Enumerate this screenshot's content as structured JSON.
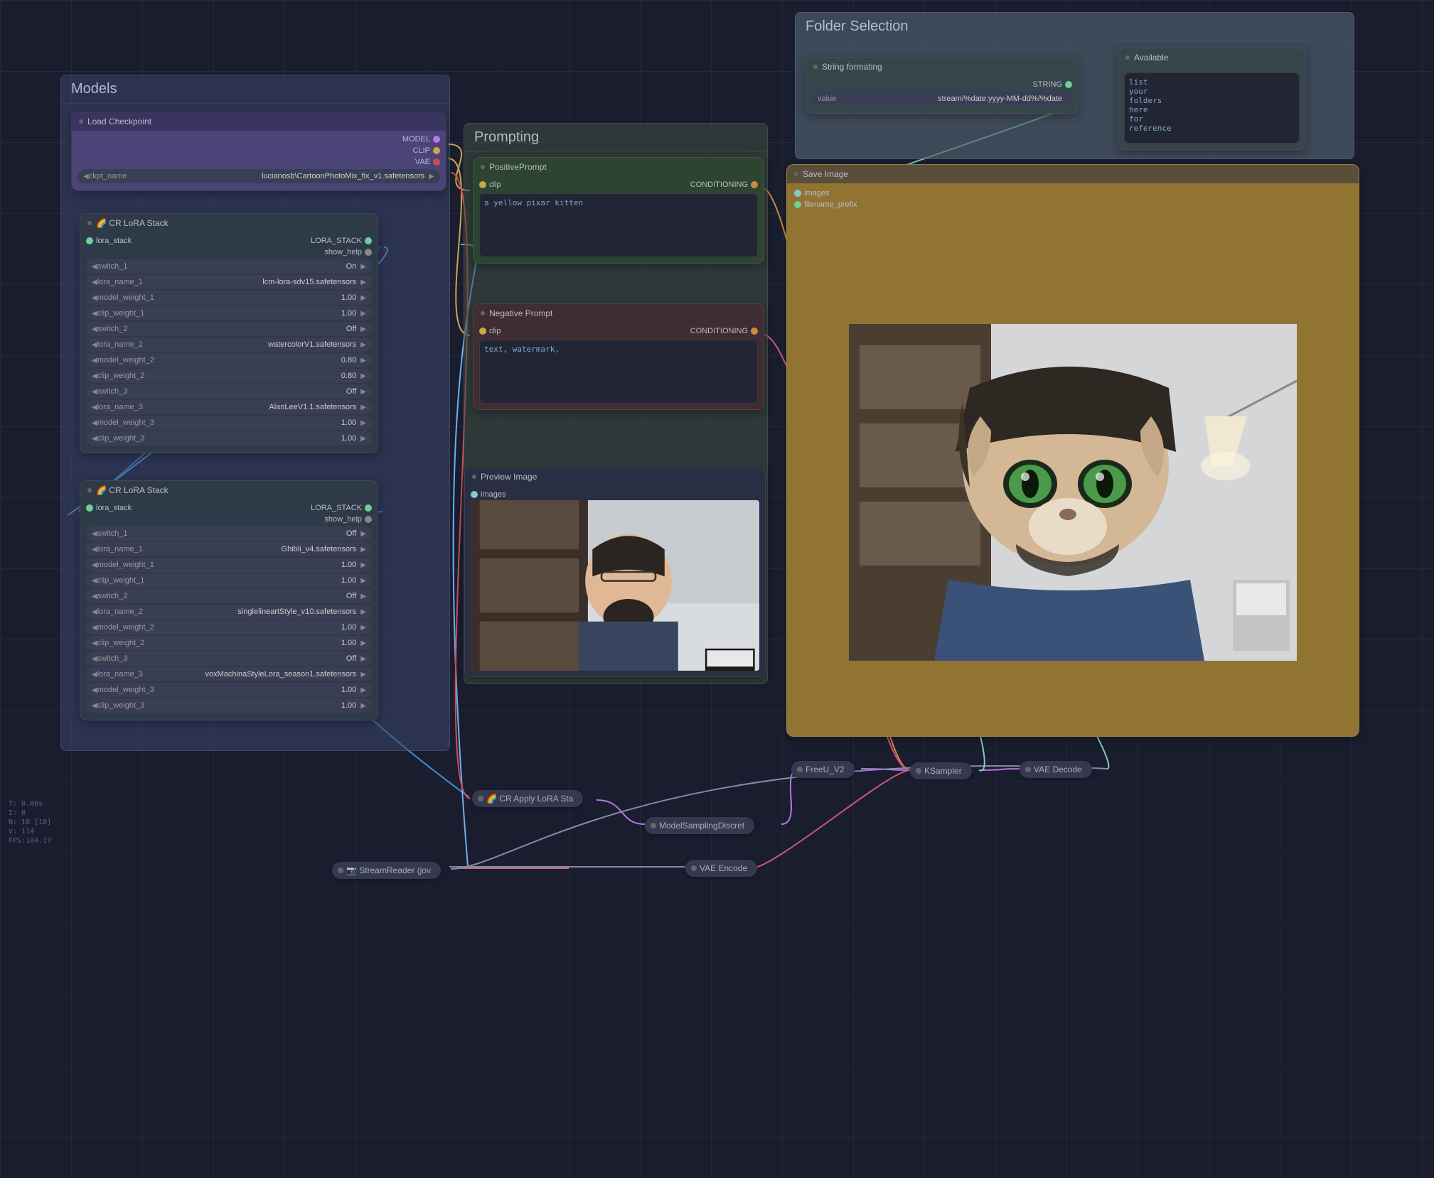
{
  "groups": {
    "models": {
      "title": "Models"
    },
    "prompting": {
      "title": "Prompting"
    },
    "folder": {
      "title": "Folder Selection"
    }
  },
  "nodes": {
    "load_checkpoint": {
      "title": "Load Checkpoint",
      "outputs": [
        "MODEL",
        "CLIP",
        "VAE"
      ],
      "widgets": [
        {
          "label": "ckpt_name",
          "value": "lucianosb\\CartoonPhotoMix_fix_v1.safetensors"
        }
      ]
    },
    "lora_stack_1": {
      "title": "🌈 CR LoRA Stack",
      "outputs": [
        "LORA_STACK",
        "show_help"
      ],
      "inputs": [
        "lora_stack"
      ],
      "widgets": [
        {
          "label": "switch_1",
          "value": "On"
        },
        {
          "label": "lora_name_1",
          "value": "lcm-lora-sdv15.safetensors"
        },
        {
          "label": "model_weight_1",
          "value": "1.00"
        },
        {
          "label": "clip_weight_1",
          "value": "1.00"
        },
        {
          "label": "switch_2",
          "value": "Off"
        },
        {
          "label": "lora_name_2",
          "value": "watercolorV1.safetensors"
        },
        {
          "label": "model_weight_2",
          "value": "0.80"
        },
        {
          "label": "clip_weight_2",
          "value": "0.80"
        },
        {
          "label": "switch_3",
          "value": "Off"
        },
        {
          "label": "lora_name_3",
          "value": "AlanLeeV1.1.safetensors"
        },
        {
          "label": "model_weight_3",
          "value": "1.00"
        },
        {
          "label": "clip_weight_3",
          "value": "1.00"
        }
      ]
    },
    "lora_stack_2": {
      "title": "🌈 CR LoRA Stack",
      "outputs": [
        "LORA_STACK",
        "show_help"
      ],
      "inputs": [
        "lora_stack"
      ],
      "widgets": [
        {
          "label": "switch_1",
          "value": "Off"
        },
        {
          "label": "lora_name_1",
          "value": "Ghibli_v4.safetensors"
        },
        {
          "label": "model_weight_1",
          "value": "1.00"
        },
        {
          "label": "clip_weight_1",
          "value": "1.00"
        },
        {
          "label": "switch_2",
          "value": "Off"
        },
        {
          "label": "lora_name_2",
          "value": "singlelineartStyle_v10.safetensors"
        },
        {
          "label": "model_weight_2",
          "value": "1.00"
        },
        {
          "label": "clip_weight_2",
          "value": "1.00"
        },
        {
          "label": "switch_3",
          "value": "Off"
        },
        {
          "label": "lora_name_3",
          "value": "voxMachinaStyleLora_season1.safetensors"
        },
        {
          "label": "model_weight_3",
          "value": "1.00"
        },
        {
          "label": "clip_weight_3",
          "value": "1.00"
        }
      ]
    },
    "positive_prompt": {
      "title": "PositivePrompt",
      "inputs": [
        "clip"
      ],
      "outputs": [
        "CONDITIONING"
      ],
      "text": "a yellow pixar kitten"
    },
    "negative_prompt": {
      "title": "Negative Prompt",
      "inputs": [
        "clip"
      ],
      "outputs": [
        "CONDITIONING"
      ],
      "text": "text, watermark,"
    },
    "preview_image": {
      "title": "Preview Image",
      "inputs": [
        "images"
      ]
    },
    "string_format": {
      "title": "String formating",
      "outputs": [
        "STRING"
      ],
      "widgets": [
        {
          "label": "value",
          "value": "stream/%date:yyyy-MM-dd%/%date"
        }
      ]
    },
    "available": {
      "title": "Available",
      "text": "list\nyour\nfolders\nhere\nfor\nreference"
    },
    "save_image": {
      "title": "Save Image",
      "inputs": [
        "images",
        "filename_prefix"
      ]
    },
    "cr_apply_lora": {
      "title": "🌈 CR Apply LoRA Sta"
    },
    "stream_reader": {
      "title": "📷 StreamReader (jov"
    },
    "vae_encode": {
      "title": "VAE Encode"
    },
    "model_sampling": {
      "title": "ModelSamplingDiscret"
    },
    "freeu": {
      "title": "FreeU_V2"
    },
    "ksampler": {
      "title": "KSampler"
    },
    "vae_decode": {
      "title": "VAE Decode"
    }
  },
  "stats": {
    "t": "T: 0.00s",
    "i": "I: 0",
    "n": "N: 18 [18]",
    "v": "V: 114",
    "fps": "FPS:104.17"
  }
}
